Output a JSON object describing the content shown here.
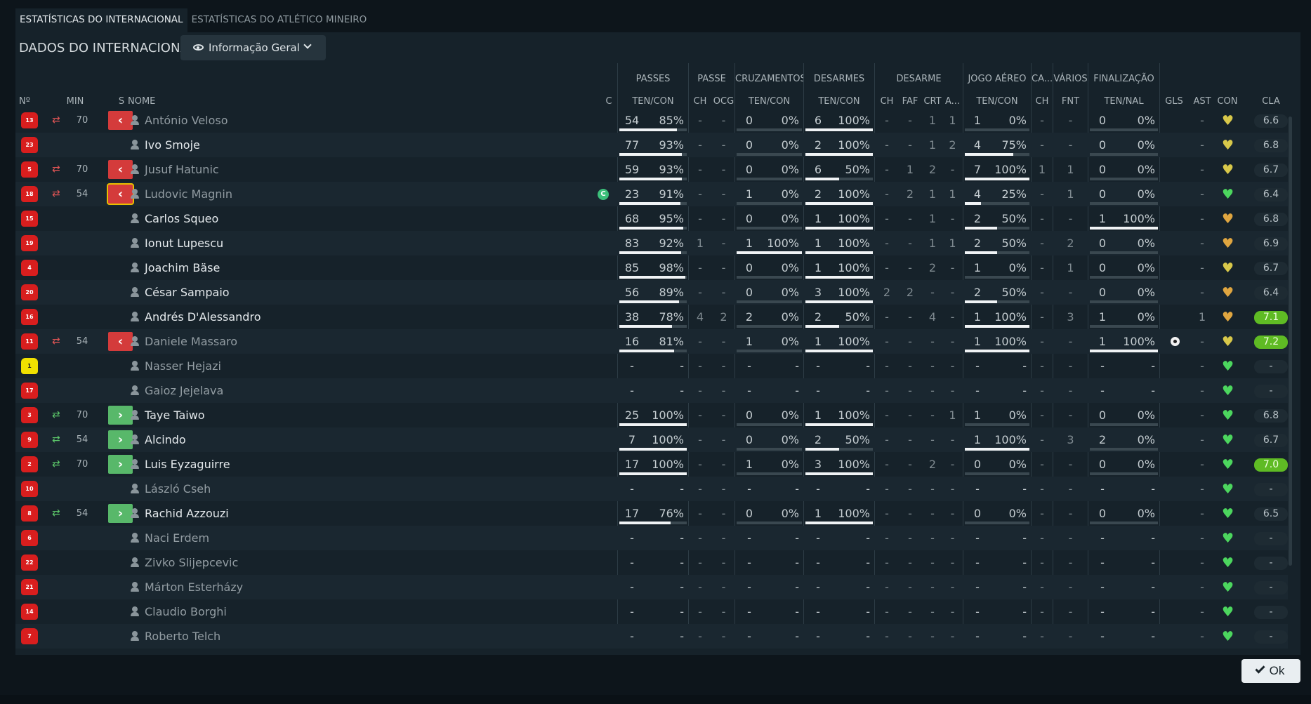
{
  "tabs": [
    {
      "label": "ESTATÍSTICAS DO INTERNACIONAL",
      "active": true
    },
    {
      "label": "ESTATÍSTICAS DO ATLÉTICO MINEIRO",
      "active": false
    }
  ],
  "panel_title": "DADOS DO INTERNACIONAL",
  "view_select": {
    "value": "Informação Geral",
    "icon": "eye-icon"
  },
  "ok_label": "Ok",
  "colors": {
    "home_shirt": "#d81e1e",
    "gk_shirt": "#f0e000",
    "sub_out": "#d43b3b",
    "sub_in": "#58b86a",
    "rating_high": "#5fbb24"
  },
  "group_headers": {
    "passes": "PASSES",
    "passe": "PASSE",
    "cruz": "CRUZAMENTOS",
    "des": "DESARMES",
    "desarme": "DESARME",
    "jogo": "JOGO AÉREO",
    "ca": "CA...",
    "varios": "VÁRIOS",
    "fin": "FINALIZAÇÃO"
  },
  "columns": {
    "no": "Nº",
    "min": "MIN",
    "s": "S",
    "nome": "NOME",
    "c": "C",
    "pass": "TEN/CON",
    "ch1": "CH",
    "ocg": "OCG",
    "cruz": "TEN/CON",
    "des": "TEN/CON",
    "ch2": "CH",
    "faf": "FAF",
    "crt": "CRT",
    "a": "A...",
    "aer": "TEN/CON",
    "ch3": "CH",
    "fnt": "FNT",
    "fin": "TEN/NAL",
    "gls": "GLS",
    "ast": "AST",
    "con": "CON",
    "cla": "CLA"
  },
  "players": [
    {
      "no": "13",
      "min": "70",
      "sub": "out",
      "name": "António Veloso",
      "starter": false,
      "cap": "",
      "pass": [
        "54",
        "85%"
      ],
      "pass_f": 0.85,
      "ch1": "-",
      "ocg": "-",
      "cruz": [
        "0",
        "0%"
      ],
      "cruz_f": 0,
      "des": [
        "6",
        "100%"
      ],
      "des_f": 1,
      "ch2": "-",
      "faf": "-",
      "crt": "1",
      "a": "1",
      "aer": [
        "1",
        "0%"
      ],
      "aer_f": 0,
      "ch3": "-",
      "fnt": "-",
      "fin": [
        "0",
        "0%"
      ],
      "fin_f": 0,
      "gls": "",
      "ast": "-",
      "con": "yellow",
      "cla": "6.6",
      "cla_hi": false,
      "ball": false
    },
    {
      "no": "23",
      "min": "",
      "sub": "",
      "name": "Ivo Smoje",
      "starter": true,
      "cap": "",
      "pass": [
        "77",
        "93%"
      ],
      "pass_f": 0.93,
      "ch1": "-",
      "ocg": "-",
      "cruz": [
        "0",
        "0%"
      ],
      "cruz_f": 0,
      "des": [
        "2",
        "100%"
      ],
      "des_f": 1,
      "ch2": "-",
      "faf": "-",
      "crt": "1",
      "a": "2",
      "aer": [
        "4",
        "75%"
      ],
      "aer_f": 0.75,
      "ch3": "-",
      "fnt": "-",
      "fin": [
        "0",
        "0%"
      ],
      "fin_f": 0,
      "gls": "",
      "ast": "-",
      "con": "yellow",
      "cla": "6.8",
      "cla_hi": false,
      "ball": false
    },
    {
      "no": "5",
      "min": "70",
      "sub": "out",
      "name": "Jusuf Hatunic",
      "starter": false,
      "cap": "",
      "pass": [
        "59",
        "93%"
      ],
      "pass_f": 0.93,
      "ch1": "-",
      "ocg": "-",
      "cruz": [
        "0",
        "0%"
      ],
      "cruz_f": 0,
      "des": [
        "6",
        "50%"
      ],
      "des_f": 0.5,
      "ch2": "-",
      "faf": "1",
      "crt": "2",
      "a": "-",
      "aer": [
        "7",
        "100%"
      ],
      "aer_f": 1,
      "ch3": "1",
      "fnt": "1",
      "fin": [
        "0",
        "0%"
      ],
      "fin_f": 0,
      "gls": "",
      "ast": "-",
      "con": "yellow",
      "cla": "6.7",
      "cla_hi": false,
      "ball": false
    },
    {
      "no": "18",
      "min": "54",
      "sub": "outsel",
      "name": "Ludovic Magnin",
      "starter": false,
      "cap": "C",
      "pass": [
        "23",
        "91%"
      ],
      "pass_f": 0.91,
      "ch1": "-",
      "ocg": "-",
      "cruz": [
        "1",
        "0%"
      ],
      "cruz_f": 0,
      "des": [
        "2",
        "100%"
      ],
      "des_f": 1,
      "ch2": "-",
      "faf": "2",
      "crt": "1",
      "a": "1",
      "aer": [
        "4",
        "25%"
      ],
      "aer_f": 0.25,
      "ch3": "-",
      "fnt": "1",
      "fin": [
        "0",
        "0%"
      ],
      "fin_f": 0,
      "gls": "",
      "ast": "-",
      "con": "green",
      "cla": "6.4",
      "cla_hi": false,
      "ball": false
    },
    {
      "no": "15",
      "min": "",
      "sub": "",
      "name": "Carlos Squeo",
      "starter": true,
      "cap": "",
      "pass": [
        "68",
        "95%"
      ],
      "pass_f": 0.95,
      "ch1": "-",
      "ocg": "-",
      "cruz": [
        "0",
        "0%"
      ],
      "cruz_f": 0,
      "des": [
        "1",
        "100%"
      ],
      "des_f": 1,
      "ch2": "-",
      "faf": "-",
      "crt": "1",
      "a": "-",
      "aer": [
        "2",
        "50%"
      ],
      "aer_f": 0.5,
      "ch3": "-",
      "fnt": "-",
      "fin": [
        "1",
        "100%"
      ],
      "fin_f": 1,
      "gls": "",
      "ast": "-",
      "con": "orange",
      "cla": "6.8",
      "cla_hi": false,
      "ball": false
    },
    {
      "no": "19",
      "min": "",
      "sub": "",
      "name": "Ionut Lupescu",
      "starter": true,
      "cap": "",
      "pass": [
        "83",
        "92%"
      ],
      "pass_f": 0.92,
      "ch1": "1",
      "ocg": "-",
      "cruz": [
        "1",
        "100%"
      ],
      "cruz_f": 1,
      "des": [
        "1",
        "100%"
      ],
      "des_f": 1,
      "ch2": "-",
      "faf": "-",
      "crt": "1",
      "a": "1",
      "aer": [
        "2",
        "50%"
      ],
      "aer_f": 0.5,
      "ch3": "-",
      "fnt": "2",
      "fin": [
        "0",
        "0%"
      ],
      "fin_f": 0,
      "gls": "",
      "ast": "-",
      "con": "orange",
      "cla": "6.9",
      "cla_hi": false,
      "ball": false
    },
    {
      "no": "4",
      "min": "",
      "sub": "",
      "name": "Joachim Bäse",
      "starter": true,
      "cap": "",
      "pass": [
        "85",
        "98%"
      ],
      "pass_f": 0.98,
      "ch1": "-",
      "ocg": "-",
      "cruz": [
        "0",
        "0%"
      ],
      "cruz_f": 0,
      "des": [
        "1",
        "100%"
      ],
      "des_f": 1,
      "ch2": "-",
      "faf": "-",
      "crt": "2",
      "a": "-",
      "aer": [
        "1",
        "0%"
      ],
      "aer_f": 0,
      "ch3": "-",
      "fnt": "1",
      "fin": [
        "0",
        "0%"
      ],
      "fin_f": 0,
      "gls": "",
      "ast": "-",
      "con": "yellow",
      "cla": "6.7",
      "cla_hi": false,
      "ball": false
    },
    {
      "no": "20",
      "min": "",
      "sub": "",
      "name": "César Sampaio",
      "starter": true,
      "cap": "",
      "pass": [
        "56",
        "89%"
      ],
      "pass_f": 0.89,
      "ch1": "-",
      "ocg": "-",
      "cruz": [
        "0",
        "0%"
      ],
      "cruz_f": 0,
      "des": [
        "3",
        "100%"
      ],
      "des_f": 1,
      "ch2": "2",
      "faf": "2",
      "crt": "-",
      "a": "-",
      "aer": [
        "2",
        "50%"
      ],
      "aer_f": 0.5,
      "ch3": "-",
      "fnt": "-",
      "fin": [
        "0",
        "0%"
      ],
      "fin_f": 0,
      "gls": "",
      "ast": "-",
      "con": "orange",
      "cla": "6.4",
      "cla_hi": false,
      "ball": false
    },
    {
      "no": "16",
      "min": "",
      "sub": "",
      "name": "Andrés D'Alessandro",
      "starter": true,
      "cap": "",
      "pass": [
        "38",
        "78%"
      ],
      "pass_f": 0.78,
      "ch1": "4",
      "ocg": "2",
      "cruz": [
        "2",
        "0%"
      ],
      "cruz_f": 0,
      "des": [
        "2",
        "50%"
      ],
      "des_f": 0.5,
      "ch2": "-",
      "faf": "-",
      "crt": "4",
      "a": "-",
      "aer": [
        "1",
        "100%"
      ],
      "aer_f": 1,
      "ch3": "-",
      "fnt": "3",
      "fin": [
        "1",
        "0%"
      ],
      "fin_f": 0,
      "gls": "",
      "ast": "1",
      "con": "orange",
      "cla": "7.1",
      "cla_hi": true,
      "ball": false
    },
    {
      "no": "11",
      "min": "54",
      "sub": "out",
      "name": "Daniele Massaro",
      "starter": false,
      "cap": "",
      "pass": [
        "16",
        "81%"
      ],
      "pass_f": 0.81,
      "ch1": "-",
      "ocg": "-",
      "cruz": [
        "1",
        "0%"
      ],
      "cruz_f": 0,
      "des": [
        "1",
        "100%"
      ],
      "des_f": 1,
      "ch2": "-",
      "faf": "-",
      "crt": "-",
      "a": "-",
      "aer": [
        "1",
        "100%"
      ],
      "aer_f": 1,
      "ch3": "-",
      "fnt": "-",
      "fin": [
        "1",
        "100%"
      ],
      "fin_f": 1,
      "gls": "",
      "ast": "-",
      "con": "yellow",
      "cla": "7.2",
      "cla_hi": true,
      "ball": true
    },
    {
      "no": "1",
      "min": "",
      "sub": "",
      "name": "Nasser Hejazi",
      "starter": false,
      "gk": true,
      "cap": "",
      "pass": [
        "-",
        "-"
      ],
      "pass_f": null,
      "ch1": "-",
      "ocg": "-",
      "cruz": [
        "-",
        "-"
      ],
      "cruz_f": null,
      "des": [
        "-",
        "-"
      ],
      "des_f": null,
      "ch2": "-",
      "faf": "-",
      "crt": "-",
      "a": "-",
      "aer": [
        "-",
        "-"
      ],
      "aer_f": null,
      "ch3": "-",
      "fnt": "-",
      "fin": [
        "-",
        "-"
      ],
      "fin_f": null,
      "gls": "",
      "ast": "-",
      "con": "green",
      "cla": "-",
      "cla_hi": false,
      "ball": false
    },
    {
      "no": "17",
      "min": "",
      "sub": "",
      "name": "Gaioz Jejelava",
      "starter": false,
      "cap": "",
      "pass": [
        "-",
        "-"
      ],
      "pass_f": null,
      "ch1": "-",
      "ocg": "-",
      "cruz": [
        "-",
        "-"
      ],
      "cruz_f": null,
      "des": [
        "-",
        "-"
      ],
      "des_f": null,
      "ch2": "-",
      "faf": "-",
      "crt": "-",
      "a": "-",
      "aer": [
        "-",
        "-"
      ],
      "aer_f": null,
      "ch3": "-",
      "fnt": "-",
      "fin": [
        "-",
        "-"
      ],
      "fin_f": null,
      "gls": "",
      "ast": "-",
      "con": "green",
      "cla": "-",
      "cla_hi": false,
      "ball": false
    },
    {
      "no": "3",
      "min": "70",
      "sub": "in",
      "name": "Taye Taiwo",
      "starter": true,
      "cap": "",
      "pass": [
        "25",
        "100%"
      ],
      "pass_f": 1,
      "ch1": "-",
      "ocg": "-",
      "cruz": [
        "0",
        "0%"
      ],
      "cruz_f": 0,
      "des": [
        "1",
        "100%"
      ],
      "des_f": 1,
      "ch2": "-",
      "faf": "-",
      "crt": "-",
      "a": "1",
      "aer": [
        "1",
        "0%"
      ],
      "aer_f": 0,
      "ch3": "-",
      "fnt": "-",
      "fin": [
        "0",
        "0%"
      ],
      "fin_f": 0,
      "gls": "",
      "ast": "-",
      "con": "green",
      "cla": "6.8",
      "cla_hi": false,
      "ball": false
    },
    {
      "no": "9",
      "min": "54",
      "sub": "in",
      "name": "Alcindo",
      "starter": true,
      "cap": "",
      "pass": [
        "7",
        "100%"
      ],
      "pass_f": 1,
      "ch1": "-",
      "ocg": "-",
      "cruz": [
        "0",
        "0%"
      ],
      "cruz_f": 0,
      "des": [
        "2",
        "50%"
      ],
      "des_f": 0.5,
      "ch2": "-",
      "faf": "-",
      "crt": "-",
      "a": "-",
      "aer": [
        "1",
        "100%"
      ],
      "aer_f": 1,
      "ch3": "-",
      "fnt": "3",
      "fin": [
        "2",
        "0%"
      ],
      "fin_f": 0,
      "gls": "",
      "ast": "-",
      "con": "green",
      "cla": "6.7",
      "cla_hi": false,
      "ball": false
    },
    {
      "no": "2",
      "min": "70",
      "sub": "in",
      "name": "Luis Eyzaguirre",
      "starter": true,
      "cap": "",
      "pass": [
        "17",
        "100%"
      ],
      "pass_f": 1,
      "ch1": "-",
      "ocg": "-",
      "cruz": [
        "1",
        "0%"
      ],
      "cruz_f": 0,
      "des": [
        "3",
        "100%"
      ],
      "des_f": 1,
      "ch2": "-",
      "faf": "-",
      "crt": "2",
      "a": "-",
      "aer": [
        "0",
        "0%"
      ],
      "aer_f": 0,
      "ch3": "-",
      "fnt": "-",
      "fin": [
        "0",
        "0%"
      ],
      "fin_f": 0,
      "gls": "",
      "ast": "-",
      "con": "green",
      "cla": "7.0",
      "cla_hi": true,
      "ball": false
    },
    {
      "no": "10",
      "min": "",
      "sub": "",
      "name": "László Cseh",
      "starter": false,
      "cap": "",
      "pass": [
        "-",
        "-"
      ],
      "pass_f": null,
      "ch1": "-",
      "ocg": "-",
      "cruz": [
        "-",
        "-"
      ],
      "cruz_f": null,
      "des": [
        "-",
        "-"
      ],
      "des_f": null,
      "ch2": "-",
      "faf": "-",
      "crt": "-",
      "a": "-",
      "aer": [
        "-",
        "-"
      ],
      "aer_f": null,
      "ch3": "-",
      "fnt": "-",
      "fin": [
        "-",
        "-"
      ],
      "fin_f": null,
      "gls": "",
      "ast": "-",
      "con": "green",
      "cla": "-",
      "cla_hi": false,
      "ball": false
    },
    {
      "no": "8",
      "min": "54",
      "sub": "in",
      "name": "Rachid Azzouzi",
      "starter": true,
      "cap": "",
      "pass": [
        "17",
        "76%"
      ],
      "pass_f": 0.76,
      "ch1": "-",
      "ocg": "-",
      "cruz": [
        "0",
        "0%"
      ],
      "cruz_f": 0,
      "des": [
        "1",
        "100%"
      ],
      "des_f": 1,
      "ch2": "-",
      "faf": "-",
      "crt": "-",
      "a": "-",
      "aer": [
        "0",
        "0%"
      ],
      "aer_f": 0,
      "ch3": "-",
      "fnt": "-",
      "fin": [
        "0",
        "0%"
      ],
      "fin_f": 0,
      "gls": "",
      "ast": "-",
      "con": "green",
      "cla": "6.5",
      "cla_hi": false,
      "ball": false
    },
    {
      "no": "6",
      "min": "",
      "sub": "",
      "name": "Naci Erdem",
      "starter": false,
      "cap": "",
      "pass": [
        "-",
        "-"
      ],
      "pass_f": null,
      "ch1": "-",
      "ocg": "-",
      "cruz": [
        "-",
        "-"
      ],
      "cruz_f": null,
      "des": [
        "-",
        "-"
      ],
      "des_f": null,
      "ch2": "-",
      "faf": "-",
      "crt": "-",
      "a": "-",
      "aer": [
        "-",
        "-"
      ],
      "aer_f": null,
      "ch3": "-",
      "fnt": "-",
      "fin": [
        "-",
        "-"
      ],
      "fin_f": null,
      "gls": "",
      "ast": "-",
      "con": "green",
      "cla": "-",
      "cla_hi": false,
      "ball": false
    },
    {
      "no": "22",
      "min": "",
      "sub": "",
      "name": "Zivko Slijepcevic",
      "starter": false,
      "cap": "",
      "pass": [
        "-",
        "-"
      ],
      "pass_f": null,
      "ch1": "-",
      "ocg": "-",
      "cruz": [
        "-",
        "-"
      ],
      "cruz_f": null,
      "des": [
        "-",
        "-"
      ],
      "des_f": null,
      "ch2": "-",
      "faf": "-",
      "crt": "-",
      "a": "-",
      "aer": [
        "-",
        "-"
      ],
      "aer_f": null,
      "ch3": "-",
      "fnt": "-",
      "fin": [
        "-",
        "-"
      ],
      "fin_f": null,
      "gls": "",
      "ast": "-",
      "con": "green",
      "cla": "-",
      "cla_hi": false,
      "ball": false
    },
    {
      "no": "21",
      "min": "",
      "sub": "",
      "name": "Márton Esterházy",
      "starter": false,
      "cap": "",
      "pass": [
        "-",
        "-"
      ],
      "pass_f": null,
      "ch1": "-",
      "ocg": "-",
      "cruz": [
        "-",
        "-"
      ],
      "cruz_f": null,
      "des": [
        "-",
        "-"
      ],
      "des_f": null,
      "ch2": "-",
      "faf": "-",
      "crt": "-",
      "a": "-",
      "aer": [
        "-",
        "-"
      ],
      "aer_f": null,
      "ch3": "-",
      "fnt": "-",
      "fin": [
        "-",
        "-"
      ],
      "fin_f": null,
      "gls": "",
      "ast": "-",
      "con": "green",
      "cla": "-",
      "cla_hi": false,
      "ball": false
    },
    {
      "no": "14",
      "min": "",
      "sub": "",
      "name": "Claudio Borghi",
      "starter": false,
      "cap": "",
      "pass": [
        "-",
        "-"
      ],
      "pass_f": null,
      "ch1": "-",
      "ocg": "-",
      "cruz": [
        "-",
        "-"
      ],
      "cruz_f": null,
      "des": [
        "-",
        "-"
      ],
      "des_f": null,
      "ch2": "-",
      "faf": "-",
      "crt": "-",
      "a": "-",
      "aer": [
        "-",
        "-"
      ],
      "aer_f": null,
      "ch3": "-",
      "fnt": "-",
      "fin": [
        "-",
        "-"
      ],
      "fin_f": null,
      "gls": "",
      "ast": "-",
      "con": "green",
      "cla": "-",
      "cla_hi": false,
      "ball": false
    },
    {
      "no": "7",
      "min": "",
      "sub": "",
      "name": "Roberto Telch",
      "starter": false,
      "cap": "",
      "pass": [
        "-",
        "-"
      ],
      "pass_f": null,
      "ch1": "-",
      "ocg": "-",
      "cruz": [
        "-",
        "-"
      ],
      "cruz_f": null,
      "des": [
        "-",
        "-"
      ],
      "des_f": null,
      "ch2": "-",
      "faf": "-",
      "crt": "-",
      "a": "-",
      "aer": [
        "-",
        "-"
      ],
      "aer_f": null,
      "ch3": "-",
      "fnt": "-",
      "fin": [
        "-",
        "-"
      ],
      "fin_f": null,
      "gls": "",
      "ast": "-",
      "con": "green",
      "cla": "-",
      "cla_hi": false,
      "ball": false
    }
  ]
}
